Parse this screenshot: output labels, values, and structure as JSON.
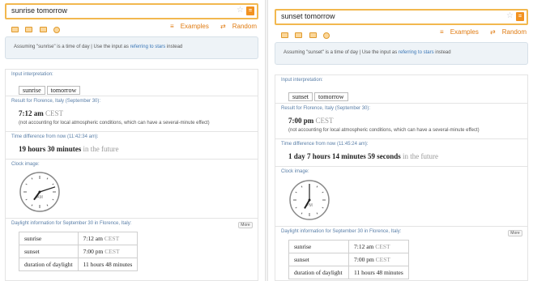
{
  "panels": [
    {
      "id": "left",
      "query": "sunrise tomorrow",
      "toolbar": {
        "examples": "Examples",
        "random": "Random"
      },
      "assumption": {
        "prefix": "Assuming \"sunrise\" is a time of day | Use the input as",
        "link": "referring to stars",
        "suffix": "instead"
      },
      "input_interpretation": {
        "title": "Input interpretation:",
        "tags": [
          "sunrise",
          "tomorrow"
        ]
      },
      "result": {
        "title": "Result for Florence, Italy (September 30):",
        "time": "7:12 am",
        "zone": "CEST",
        "note": "(not accounting for local atmospheric conditions, which can have a several-minute effect)"
      },
      "time_diff": {
        "title": "Time difference from now (11:42:34 am):",
        "value": "19 hours 30 minutes",
        "suffix": "in the future"
      },
      "clock": {
        "title": "Clock image:",
        "label": "AM",
        "hour": 7,
        "minute": 12
      },
      "daylight": {
        "title": "Daylight information for September 30 in Florence, Italy:",
        "more": "More",
        "rows": [
          {
            "label": "sunrise",
            "value": "7:12 am",
            "zone": "CEST"
          },
          {
            "label": "sunset",
            "value": "7:00 pm",
            "zone": "CEST"
          },
          {
            "label": "duration of daylight",
            "value": "11 hours 48 minutes",
            "zone": ""
          }
        ]
      }
    },
    {
      "id": "right",
      "query": "sunset tomorrow",
      "toolbar": {
        "examples": "Examples",
        "random": "Random"
      },
      "assumption": {
        "prefix": "Assuming \"sunset\" is a time of day | Use the input as",
        "link": "referring to stars",
        "suffix": "instead"
      },
      "input_interpretation": {
        "title": "Input interpretation:",
        "tags": [
          "sunset",
          "tomorrow"
        ]
      },
      "result": {
        "title": "Result for Florence, Italy (September 30):",
        "time": "7:00 pm",
        "zone": "CEST",
        "note": "(not accounting for local atmospheric conditions, which can have a several-minute effect)"
      },
      "time_diff": {
        "title": "Time difference from now (11:45:24 am):",
        "value": "1 day 7 hours 14 minutes 59 seconds",
        "suffix": "in the future"
      },
      "clock": {
        "title": "Clock image:",
        "label": "PM",
        "hour": 7,
        "minute": 0
      },
      "daylight": {
        "title": "Daylight information for September 30 in Florence, Italy:",
        "more": "More",
        "rows": [
          {
            "label": "sunrise",
            "value": "7:12 am",
            "zone": "CEST"
          },
          {
            "label": "sunset",
            "value": "7:00 pm",
            "zone": "CEST"
          },
          {
            "label": "duration of daylight",
            "value": "11 hours 48 minutes",
            "zone": ""
          }
        ]
      }
    }
  ],
  "colors": {
    "accent": "#f29220",
    "search_border": "#f2b84f",
    "pod_title": "#5a7fa8",
    "link": "#3a76b6"
  }
}
